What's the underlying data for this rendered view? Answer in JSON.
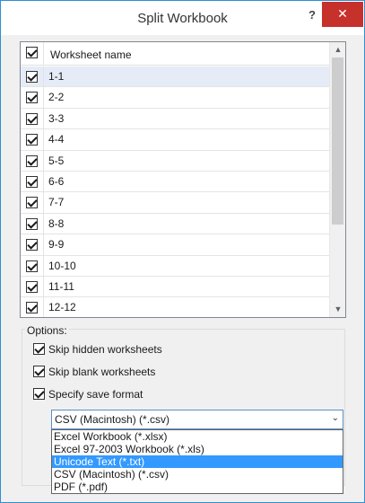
{
  "window": {
    "title": "Split Workbook",
    "help_glyph": "?",
    "close_glyph": "✕"
  },
  "worksheets": {
    "header_label": "Worksheet name",
    "header_checked": true,
    "rows": [
      {
        "name": "1-1",
        "checked": true,
        "selected": true
      },
      {
        "name": "2-2",
        "checked": true,
        "selected": false
      },
      {
        "name": "3-3",
        "checked": true,
        "selected": false
      },
      {
        "name": "4-4",
        "checked": true,
        "selected": false
      },
      {
        "name": "5-5",
        "checked": true,
        "selected": false
      },
      {
        "name": "6-6",
        "checked": true,
        "selected": false
      },
      {
        "name": "7-7",
        "checked": true,
        "selected": false
      },
      {
        "name": "8-8",
        "checked": true,
        "selected": false
      },
      {
        "name": "9-9",
        "checked": true,
        "selected": false
      },
      {
        "name": "10-10",
        "checked": true,
        "selected": false
      },
      {
        "name": "11-11",
        "checked": true,
        "selected": false
      },
      {
        "name": "12-12",
        "checked": true,
        "selected": false
      }
    ],
    "scroll_up_glyph": "▲",
    "scroll_down_glyph": "▼"
  },
  "options": {
    "label": "Options:",
    "skip_hidden": {
      "label": "Skip hidden worksheets",
      "checked": true
    },
    "skip_blank": {
      "label": "Skip blank worksheets",
      "checked": true
    },
    "specify_format": {
      "label": "Specify save format",
      "checked": true
    }
  },
  "save_format": {
    "selected": "CSV (Macintosh) (*.csv)",
    "arrow_glyph": "⌄",
    "options": [
      {
        "label": "Excel Workbook (*.xlsx)",
        "highlight": false
      },
      {
        "label": "Excel 97-2003 Workbook (*.xls)",
        "highlight": false
      },
      {
        "label": "Unicode Text (*.txt)",
        "highlight": true
      },
      {
        "label": "CSV (Macintosh) (*.csv)",
        "highlight": false
      },
      {
        "label": "PDF (*.pdf)",
        "highlight": false
      }
    ]
  },
  "colors": {
    "accent_border": "#2e8fd0",
    "close_button": "#c7312b",
    "highlight": "#3399ff",
    "selected_row": "#e5ecf7"
  }
}
